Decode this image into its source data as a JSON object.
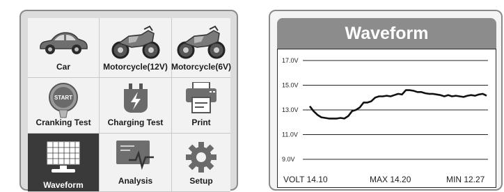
{
  "menu": {
    "items": [
      {
        "label": "Car",
        "icon": "car-icon"
      },
      {
        "label": "Motorcycle(12V)",
        "icon": "motorcycle-icon"
      },
      {
        "label": "Motorcycle(6V)",
        "icon": "motorcycle-icon"
      },
      {
        "label": "Cranking Test",
        "icon": "start-button-icon",
        "icon_text": "START"
      },
      {
        "label": "Charging Test",
        "icon": "battery-charge-icon"
      },
      {
        "label": "Print",
        "icon": "printer-icon"
      },
      {
        "label": "Waveform",
        "icon": "monitor-waveform-icon",
        "selected": true
      },
      {
        "label": "Analysis",
        "icon": "analysis-screen-icon"
      },
      {
        "label": "Setup",
        "icon": "gear-icon"
      }
    ]
  },
  "waveform": {
    "title": "Waveform",
    "volt_label": "VOLT 14.10",
    "max_label": "MAX 14.20",
    "min_label": "MIN 12.27"
  },
  "chart_data": {
    "type": "line",
    "title": "",
    "xlabel": "",
    "ylabel": "",
    "ylim": [
      9.0,
      17.0
    ],
    "yticks": [
      "17.0V",
      "15.0V",
      "13.0V",
      "11.0V",
      "9.0V"
    ],
    "ytick_values": [
      17.0,
      15.0,
      13.0,
      11.0,
      9.0
    ],
    "grid": true,
    "series": [
      {
        "values": [
          13.3,
          12.9,
          12.6,
          12.4,
          12.35,
          12.3,
          12.3,
          12.3,
          12.35,
          12.3,
          12.5,
          12.9,
          13.0,
          13.2,
          13.6,
          13.6,
          13.7,
          14.0,
          14.1,
          14.1,
          14.15,
          14.1,
          14.2,
          14.3,
          14.25,
          14.6,
          14.6,
          14.55,
          14.45,
          14.45,
          14.35,
          14.3,
          14.3,
          14.25,
          14.2,
          14.1,
          14.2,
          14.1,
          14.15,
          14.1,
          14.05,
          14.15,
          14.2,
          14.15,
          14.25,
          14.3,
          14.15
        ]
      }
    ],
    "colors": {
      "line": "#111111",
      "grid": "#222222"
    }
  }
}
